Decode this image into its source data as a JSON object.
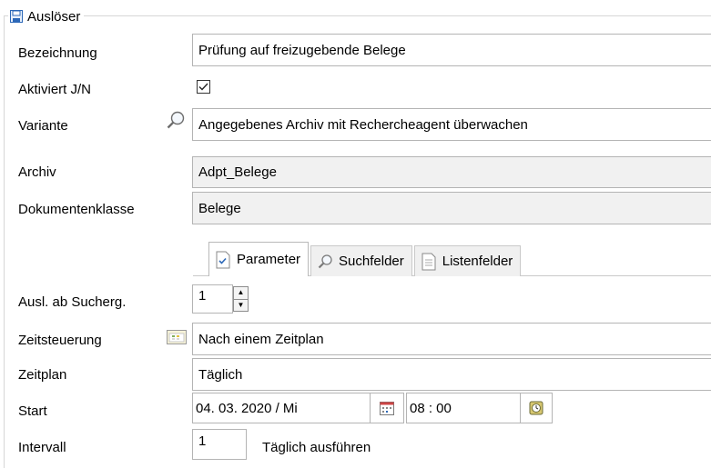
{
  "group": {
    "title": "Auslöser",
    "icon": "save-icon"
  },
  "fields": {
    "bezeichnung": {
      "label": "Bezeichnung",
      "value": "Prüfung auf freizugebende Belege"
    },
    "aktiviert": {
      "label": "Aktiviert J/N",
      "checked": true
    },
    "variante": {
      "label": "Variante",
      "value": "Angegebenes Archiv mit Rechercheagent überwachen",
      "icon": "search-icon"
    },
    "archiv": {
      "label": "Archiv",
      "value": "Adpt_Belege"
    },
    "dokumentenklasse": {
      "label": "Dokumentenklasse",
      "value": "Belege"
    },
    "ausl_ab": {
      "label": "Ausl. ab Sucherg.",
      "value": "1"
    },
    "zeitsteuerung": {
      "label": "Zeitsteuerung",
      "value": "Nach einem Zeitplan",
      "icon": "calendar-grid-icon"
    },
    "zeitplan": {
      "label": "Zeitplan",
      "value": "Täglich"
    },
    "start": {
      "label": "Start",
      "date": "04. 03. 2020 / Mi",
      "time": "08 : 00",
      "date_icon": "calendar-icon",
      "time_icon": "clock-icon"
    },
    "intervall": {
      "label": "Intervall",
      "value": "1",
      "suffix": "Täglich ausführen"
    }
  },
  "tabs": [
    {
      "label": "Parameter",
      "icon": "checked-document-icon",
      "active": true
    },
    {
      "label": "Suchfelder",
      "icon": "search-icon",
      "active": false
    },
    {
      "label": "Listenfelder",
      "icon": "document-icon",
      "active": false
    }
  ]
}
